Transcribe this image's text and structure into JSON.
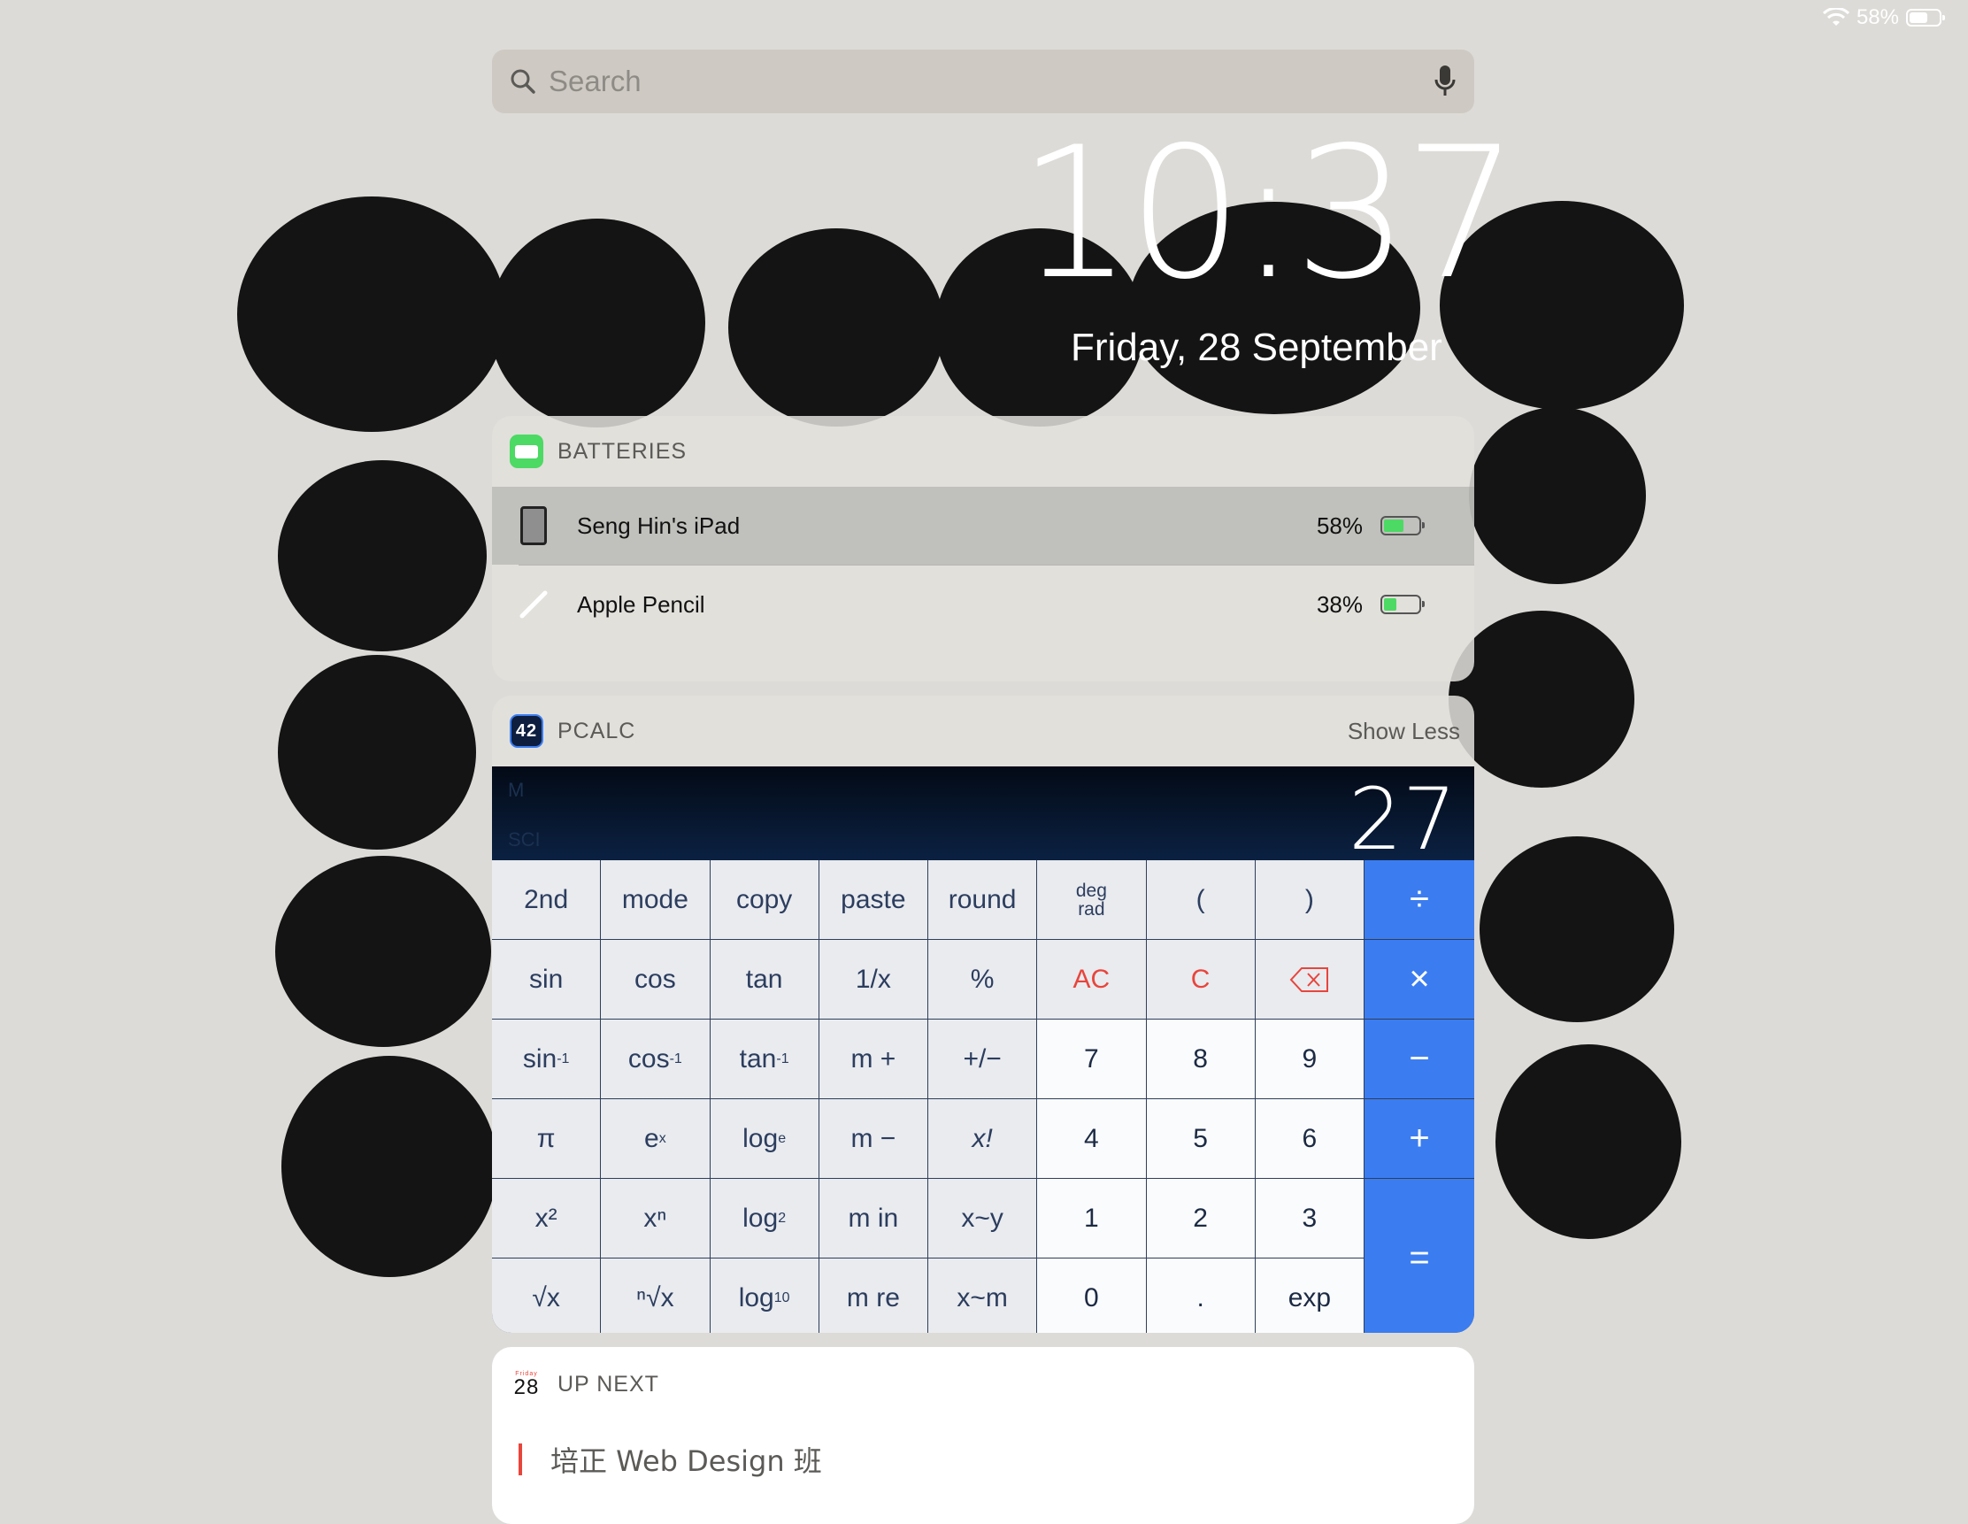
{
  "status": {
    "battery_text": "58%",
    "wifi_icon": "wifi-icon",
    "battery_icon": "battery-icon"
  },
  "search": {
    "placeholder": "Search"
  },
  "lock": {
    "time": "10:37",
    "date": "Friday, 28 September"
  },
  "batteries": {
    "title": "BATTERIES",
    "devices": [
      {
        "name": "Seng Hin's iPad",
        "percent": "58%",
        "level": 0.58,
        "icon": "ipad-icon"
      },
      {
        "name": "Apple Pencil",
        "percent": "38%",
        "level": 0.38,
        "icon": "pencil-icon"
      }
    ]
  },
  "pcalc": {
    "title": "PCALC",
    "app_icon_text": "42",
    "action": "Show Less",
    "display": {
      "memory": "M",
      "mode": "SCI",
      "value": "27"
    },
    "keys": {
      "second": "2nd",
      "mode": "mode",
      "copy": "copy",
      "paste": "paste",
      "round": "round",
      "deg": "deg",
      "rad": "rad",
      "lparen": "(",
      "rparen": ")",
      "divide": "÷",
      "sin": "sin",
      "cos": "cos",
      "tan": "tan",
      "recip": "1/x",
      "percent": "%",
      "ac": "AC",
      "c": "C",
      "multiply": "×",
      "asin_base": "sin",
      "acos_base": "cos",
      "atan_base": "tan",
      "inv_sup": "-1",
      "mplus": "m +",
      "plusminus": "+/−",
      "seven": "7",
      "eight": "8",
      "nine": "9",
      "minus": "−",
      "pi": "π",
      "e_base": "e",
      "e_sup": "x",
      "log_base": "log",
      "loge_sub": "e",
      "mminus": "m −",
      "fact": "x!",
      "four": "4",
      "five": "5",
      "six": "6",
      "plus": "+",
      "x2": "x²",
      "xn": "xⁿ",
      "log2_sub": "2",
      "min": "m in",
      "xy": "x~y",
      "one": "1",
      "two": "2",
      "three": "3",
      "equals": "=",
      "sqrt": "√x",
      "nroot": "ⁿ√x",
      "log10_sub": "10",
      "mre": "m re",
      "xm": "x~m",
      "zero": "0",
      "dot": ".",
      "exp": "exp"
    }
  },
  "upnext": {
    "title": "UP NEXT",
    "cal_day": "28",
    "cal_weekday": "Friday",
    "event": "培正 Web Design 班"
  },
  "colors": {
    "accent": "#3b7df0",
    "danger": "#e8453c",
    "battery": "#4cd964",
    "display": "#0b2142"
  }
}
